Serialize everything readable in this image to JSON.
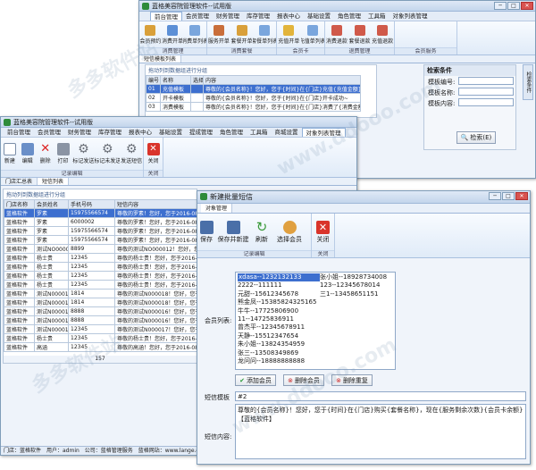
{
  "bg_window": {
    "title": "蓝格美容院管理软件--试用版",
    "menu": [
      "前台管理",
      "会员管理",
      "财务管理",
      "库存管理",
      "报表中心",
      "基础设置",
      "角色管理",
      "工具箱",
      "对象列表管理"
    ],
    "ribbon_buttons": [
      "会员预约",
      "消费开单",
      "消费单列表",
      "服务开单",
      "套餐开单",
      "套餐单列表",
      "充值开单",
      "充值单列表",
      "消费退款",
      "套餐退款",
      "充值退款"
    ],
    "ribbon_groups": [
      "消费管理",
      "消费套餐",
      "会员卡",
      "退费管理",
      "会员服务"
    ],
    "tab": "短信模板列表",
    "crumb": "拖动列到数据组进行分组",
    "table_headers": [
      "编号",
      "名称",
      "选择",
      "内容"
    ],
    "rows": [
      [
        "01",
        "充值模板",
        "",
        "尊敬的{会员名称}！您好，您于{时间}在{门店}充值{充值金额}元"
      ],
      [
        "02",
        "开卡模板",
        "",
        "尊敬的{会员名称}！您好，您于{时间}在{门店}开卡成功~"
      ],
      [
        "03",
        "消费模板",
        "",
        "尊敬的{会员名称}！您好，您于{时间}在{门店}消费了{消费金额}元"
      ]
    ],
    "search": {
      "title": "检索条件",
      "labels": [
        "模板编号:",
        "模板名称:",
        "模板内容:"
      ],
      "button": "检索(E)"
    },
    "side_tab": "检索条件"
  },
  "mid_window": {
    "title": "蓝格美容院管理软件--试用版",
    "menu": [
      "前台管理",
      "会员管理",
      "财务管理",
      "库存管理",
      "报表中心",
      "基础设置",
      "提成管理",
      "角色管理",
      "工具箱",
      "商城设置",
      "对象列表管理"
    ],
    "ribbon_buttons": [
      "新建",
      "编辑",
      "删除",
      "打印",
      "标记发送",
      "标记未发送",
      "发送短信",
      "关闭"
    ],
    "ribbon_groups": [
      "记录编辑",
      "关闭"
    ],
    "tabs": [
      "门店汇总表",
      "短信列表"
    ],
    "crumb": "拖动列到数据组进行分组",
    "table_headers": [
      "门店名称",
      "会员姓名",
      "手机号码",
      "短信内容"
    ],
    "rows": [
      [
        "蓝格软件",
        "罗素",
        "15975566574",
        "尊敬的罗素！您好，您于2016-08-1"
      ],
      [
        "蓝格软件",
        "罗素",
        "6000002",
        "尊敬的罗素！您好，您于2016-08-1"
      ],
      [
        "蓝格软件",
        "罗素",
        "15975566574",
        "尊敬的罗素！您好，您于2016-08-1"
      ],
      [
        "蓝格软件",
        "罗素",
        "15975566574",
        "尊敬的罗素！您好，您于2016-08-1"
      ],
      [
        "蓝格软件",
        "测试NO000012",
        "8899",
        "尊敬的测试NO000012！您好，您于2"
      ],
      [
        "蓝格软件",
        "杨士贵",
        "12345",
        "尊敬的杨士贵！您好，您于2016-08"
      ],
      [
        "蓝格软件",
        "杨士贵",
        "12345",
        "尊敬的杨士贵！您好，您于2016-08"
      ],
      [
        "蓝格软件",
        "杨士贵",
        "12345",
        "尊敬的杨士贵！您好，您于2016-08"
      ],
      [
        "蓝格软件",
        "杨士贵",
        "12345",
        "尊敬的杨士贵！您好，您于2016-08"
      ],
      [
        "蓝格软件",
        "测试N000018",
        "1814",
        "尊敬的测试N000018！您好，您于2"
      ],
      [
        "蓝格软件",
        "测试N000018",
        "1814",
        "尊敬的测试N000018！您好，您于2"
      ],
      [
        "蓝格软件",
        "测试N000016",
        "8888",
        "尊敬的测试N000016！您好，您于2"
      ],
      [
        "蓝格软件",
        "测试N000016",
        "8888",
        "尊敬的测试N000016！您好，您于2"
      ],
      [
        "蓝格软件",
        "测试N000017",
        "12345",
        "尊敬的测试N000017！您好，您于2"
      ],
      [
        "蓝格软件",
        "杨士贵",
        "12345",
        "尊敬的杨士贵！您好，您于2016-08"
      ],
      [
        "蓝格软件",
        "高涵",
        "12345",
        "尊敬的高涵！您好，您于2016-08"
      ]
    ],
    "count": "157",
    "status": "门店：蓝格软件　用户：admin　公司：蓝格管理服务　蓝格网站：www.lange.com.cn"
  },
  "dialog": {
    "title": "新建批量短信",
    "tab": "对象管理",
    "ribbon_buttons": [
      "保存",
      "保存并新建",
      "刷新",
      "选择会员",
      "关闭"
    ],
    "ribbon_groups": [
      "记录编辑",
      "关闭"
    ],
    "member_label": "会员列表:",
    "members_col1": [
      "xdasa--1232132133",
      "2222--111111",
      "元甜--15612345678",
      "熊金凤--15385824325165",
      "牛牛--17725806900",
      "11--14725836911",
      "曾杰平--12345678911",
      "天静--15512347654",
      "朱小姐--13824354959",
      "张三--13508349869",
      "龙问问--18888888888"
    ],
    "members_col2": [
      "张小姐--18928734008",
      "123--12345678014",
      "三1--13458651151"
    ],
    "buttons": [
      "添加会员",
      "删除会员",
      "删除重复"
    ],
    "template_label": "短信模板",
    "template_value": "#2",
    "content_label": "短信内容:",
    "content_value": "尊敬的{会员名称}！您好，您于{时间}在{门店}购买{套餐名称}，现在{服务剩余次数}{会员卡余额}【蓝格软件】"
  },
  "watermarks": [
    "多多软件站",
    "www.ddooo.com",
    "多多软件站",
    "www.ddooo.com"
  ],
  "colors": {
    "accent": "#3d6fcf",
    "ribbon": "#e0ebf8",
    "title": "#c3d5ec"
  }
}
